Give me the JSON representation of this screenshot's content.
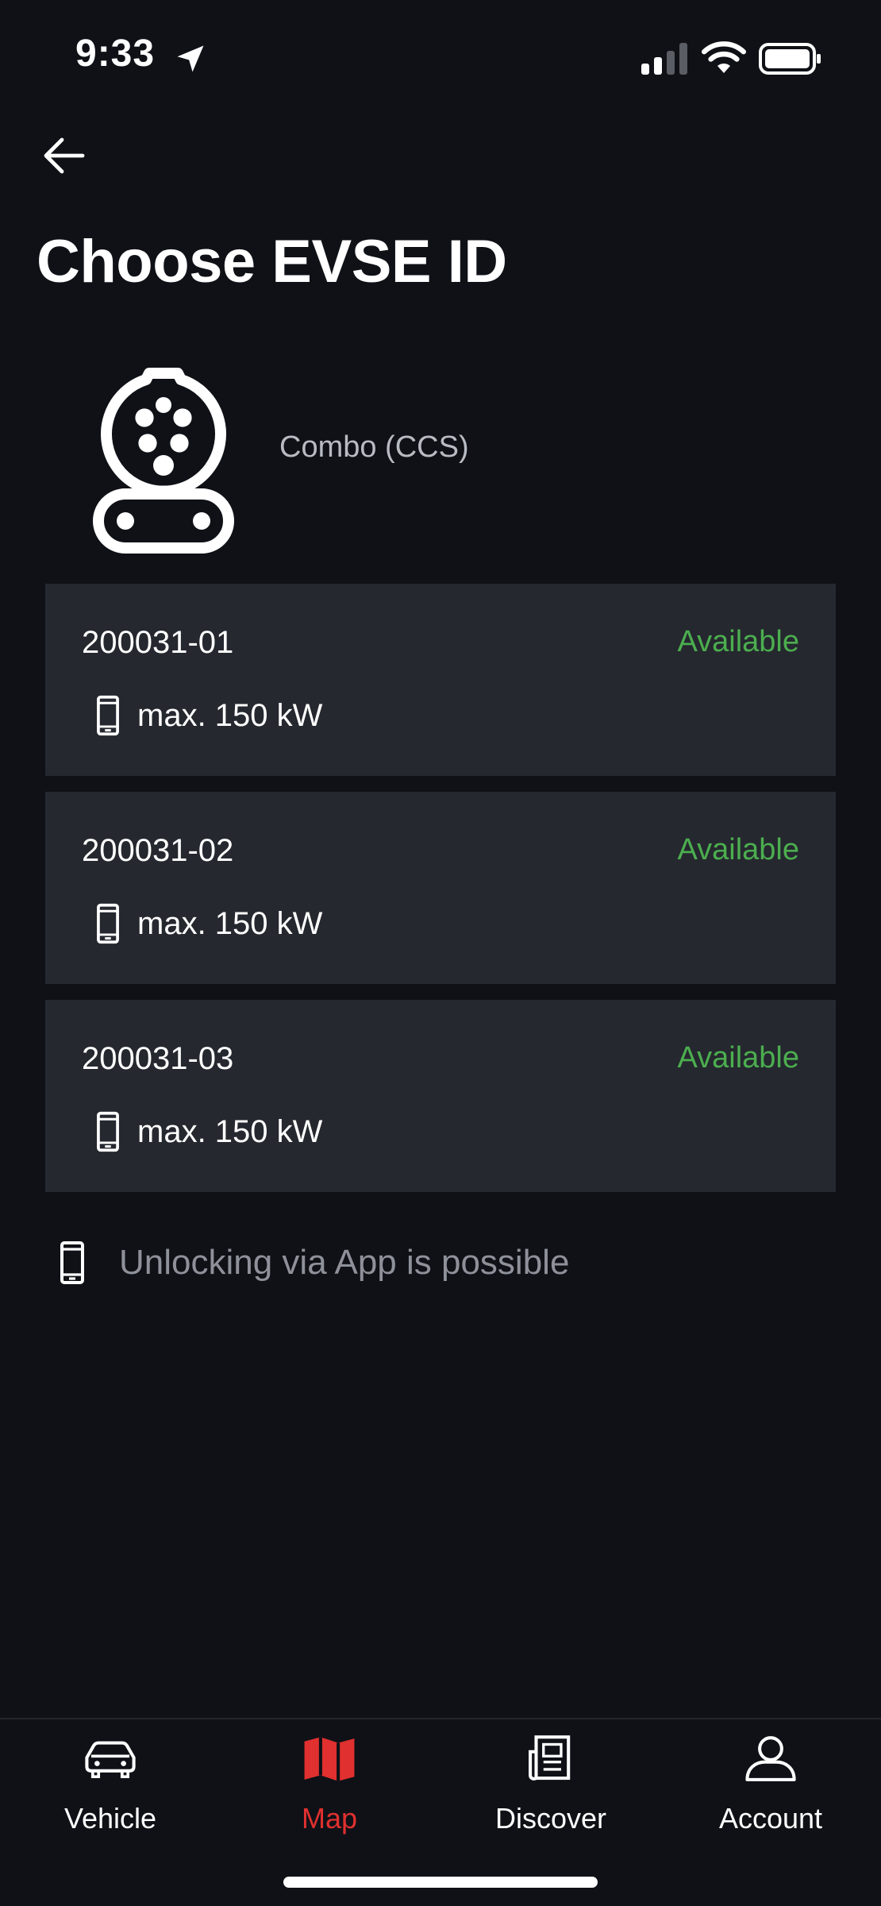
{
  "status_bar": {
    "time": "9:33",
    "icons": [
      "location-arrow-icon",
      "cellular-signal-icon",
      "wifi-icon",
      "battery-icon"
    ]
  },
  "header": {
    "back_icon": "arrow-left-icon",
    "title": "Choose EVSE ID"
  },
  "connector": {
    "icon": "ccs-combo-connector-icon",
    "label": "Combo (CCS)"
  },
  "evse_items": [
    {
      "id": "200031-01",
      "status": "Available",
      "power": "max. 150 kW",
      "icon": "phone-icon"
    },
    {
      "id": "200031-02",
      "status": "Available",
      "power": "max. 150 kW",
      "icon": "phone-icon"
    },
    {
      "id": "200031-03",
      "status": "Available",
      "power": "max. 150 kW",
      "icon": "phone-icon"
    }
  ],
  "info": {
    "icon": "phone-icon",
    "text": "Unlocking via App is possible"
  },
  "bottom_nav": {
    "items": [
      {
        "label": "Vehicle",
        "icon": "car-icon",
        "active": false
      },
      {
        "label": "Map",
        "icon": "map-icon",
        "active": true
      },
      {
        "label": "Discover",
        "icon": "news-icon",
        "active": false
      },
      {
        "label": "Account",
        "icon": "user-icon",
        "active": false
      }
    ]
  },
  "colors": {
    "background": "#0f1117",
    "card": "#25282f",
    "available": "#4cae4f",
    "active_nav": "#e0302f",
    "muted_text": "#8e9199"
  }
}
